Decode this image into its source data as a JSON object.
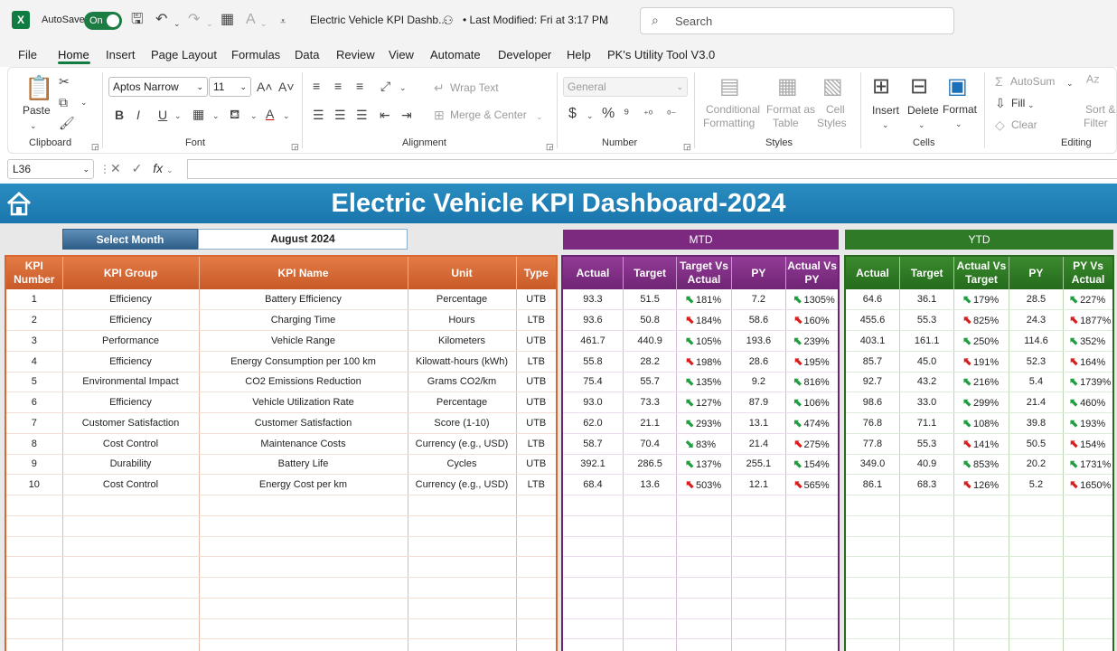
{
  "titlebar": {
    "autosave_label": "AutoSave",
    "autosave_state": "On",
    "doc_title": "Electric Vehicle KPI Dashb...",
    "last_modified": "• Last Modified: Fri at 3:17 PM",
    "search_placeholder": "Search"
  },
  "menu": [
    "File",
    "Home",
    "Insert",
    "Page Layout",
    "Formulas",
    "Data",
    "Review",
    "View",
    "Automate",
    "Developer",
    "Help",
    "PK's Utility Tool V3.0"
  ],
  "ribbon": {
    "paste": "Paste",
    "clipboard": "Clipboard",
    "font_name": "Aptos Narrow",
    "font_size": "11",
    "font": "Font",
    "wrap_text": "Wrap Text",
    "merge_center": "Merge & Center",
    "alignment": "Alignment",
    "number_format": "General",
    "number": "Number",
    "conditional_formatting_1": "Conditional",
    "conditional_formatting_2": "Formatting",
    "format_as_table_1": "Format as",
    "format_as_table_2": "Table",
    "cell_styles_1": "Cell",
    "cell_styles_2": "Styles",
    "styles": "Styles",
    "insert": "Insert",
    "delete": "Delete",
    "format": "Format",
    "cells": "Cells",
    "autosum": "AutoSum",
    "fill": "Fill",
    "clear": "Clear",
    "sort_filter_1": "Sort &",
    "sort_filter_2": "Filter",
    "editing": "Editing"
  },
  "formula_bar": {
    "name_box": "L36",
    "fx": "fx",
    "value": ""
  },
  "dashboard": {
    "title": "Electric Vehicle KPI Dashboard-2024",
    "select_month_label": "Select Month",
    "select_month_value": "August 2024",
    "mtd_label": "MTD",
    "ytd_label": "YTD"
  },
  "kpi_headers": [
    "KPI Number",
    "KPI Group",
    "KPI Name",
    "Unit",
    "Type"
  ],
  "mtd_headers": [
    "Actual",
    "Target",
    "Target Vs Actual",
    "PY",
    "Actual Vs PY"
  ],
  "ytd_headers": [
    "Actual",
    "Target",
    "Actual Vs Target",
    "PY",
    "PY Vs Actual"
  ],
  "rows": [
    {
      "num": "1",
      "group": "Efficiency",
      "name": "Battery Efficiency",
      "unit": "Percentage",
      "type": "UTB",
      "mtd": {
        "actual": "93.3",
        "target": "51.5",
        "tva_dir": "up",
        "tva": "181%",
        "py": "7.2",
        "avp_dir": "up",
        "avp": "1305%"
      },
      "ytd": {
        "actual": "64.6",
        "target": "36.1",
        "avt_dir": "up",
        "avt": "179%",
        "py": "28.5",
        "pva_dir": "up",
        "pva": "227%"
      }
    },
    {
      "num": "2",
      "group": "Efficiency",
      "name": "Charging Time",
      "unit": "Hours",
      "type": "LTB",
      "mtd": {
        "actual": "93.6",
        "target": "50.8",
        "tva_dir": "down",
        "tva": "184%",
        "py": "58.6",
        "avp_dir": "down",
        "avp": "160%"
      },
      "ytd": {
        "actual": "455.6",
        "target": "55.3",
        "avt_dir": "down",
        "avt": "825%",
        "py": "24.3",
        "pva_dir": "down",
        "pva": "1877%"
      }
    },
    {
      "num": "3",
      "group": "Performance",
      "name": "Vehicle Range",
      "unit": "Kilometers",
      "type": "UTB",
      "mtd": {
        "actual": "461.7",
        "target": "440.9",
        "tva_dir": "up",
        "tva": "105%",
        "py": "193.6",
        "avp_dir": "up",
        "avp": "239%"
      },
      "ytd": {
        "actual": "403.1",
        "target": "161.1",
        "avt_dir": "up",
        "avt": "250%",
        "py": "114.6",
        "pva_dir": "up",
        "pva": "352%"
      }
    },
    {
      "num": "4",
      "group": "Efficiency",
      "name": "Energy Consumption per 100 km",
      "unit": "Kilowatt-hours (kWh)",
      "type": "LTB",
      "mtd": {
        "actual": "55.8",
        "target": "28.2",
        "tva_dir": "down",
        "tva": "198%",
        "py": "28.6",
        "avp_dir": "down",
        "avp": "195%"
      },
      "ytd": {
        "actual": "85.7",
        "target": "45.0",
        "avt_dir": "down",
        "avt": "191%",
        "py": "52.3",
        "pva_dir": "down",
        "pva": "164%"
      }
    },
    {
      "num": "5",
      "group": "Environmental Impact",
      "name": "CO2 Emissions Reduction",
      "unit": "Grams CO2/km",
      "type": "UTB",
      "mtd": {
        "actual": "75.4",
        "target": "55.7",
        "tva_dir": "up",
        "tva": "135%",
        "py": "9.2",
        "avp_dir": "up",
        "avp": "816%"
      },
      "ytd": {
        "actual": "92.7",
        "target": "43.2",
        "avt_dir": "up",
        "avt": "216%",
        "py": "5.4",
        "pva_dir": "up",
        "pva": "1739%"
      }
    },
    {
      "num": "6",
      "group": "Efficiency",
      "name": "Vehicle Utilization Rate",
      "unit": "Percentage",
      "type": "UTB",
      "mtd": {
        "actual": "93.0",
        "target": "73.3",
        "tva_dir": "up",
        "tva": "127%",
        "py": "87.9",
        "avp_dir": "up",
        "avp": "106%"
      },
      "ytd": {
        "actual": "98.6",
        "target": "33.0",
        "avt_dir": "up",
        "avt": "299%",
        "py": "21.4",
        "pva_dir": "up",
        "pva": "460%"
      }
    },
    {
      "num": "7",
      "group": "Customer Satisfaction",
      "name": "Customer Satisfaction",
      "unit": "Score (1-10)",
      "type": "UTB",
      "mtd": {
        "actual": "62.0",
        "target": "21.1",
        "tva_dir": "up",
        "tva": "293%",
        "py": "13.1",
        "avp_dir": "up",
        "avp": "474%"
      },
      "ytd": {
        "actual": "76.8",
        "target": "71.1",
        "avt_dir": "up",
        "avt": "108%",
        "py": "39.8",
        "pva_dir": "up",
        "pva": "193%"
      }
    },
    {
      "num": "8",
      "group": "Cost Control",
      "name": "Maintenance Costs",
      "unit": "Currency (e.g., USD)",
      "type": "LTB",
      "mtd": {
        "actual": "58.7",
        "target": "70.4",
        "tva_dir": "up",
        "tva": "83%",
        "py": "21.4",
        "avp_dir": "down",
        "avp": "275%"
      },
      "ytd": {
        "actual": "77.8",
        "target": "55.3",
        "avt_dir": "down",
        "avt": "141%",
        "py": "50.5",
        "pva_dir": "down",
        "pva": "154%"
      }
    },
    {
      "num": "9",
      "group": "Durability",
      "name": "Battery Life",
      "unit": "Cycles",
      "type": "UTB",
      "mtd": {
        "actual": "392.1",
        "target": "286.5",
        "tva_dir": "up",
        "tva": "137%",
        "py": "255.1",
        "avp_dir": "up",
        "avp": "154%"
      },
      "ytd": {
        "actual": "349.0",
        "target": "40.9",
        "avt_dir": "up",
        "avt": "853%",
        "py": "20.2",
        "pva_dir": "up",
        "pva": "1731%"
      }
    },
    {
      "num": "10",
      "group": "Cost Control",
      "name": "Energy Cost per km",
      "unit": "Currency (e.g., USD)",
      "type": "LTB",
      "mtd": {
        "actual": "68.4",
        "target": "13.6",
        "tva_dir": "down",
        "tva": "503%",
        "py": "12.1",
        "avp_dir": "down",
        "avp": "565%"
      },
      "ytd": {
        "actual": "86.1",
        "target": "68.3",
        "avt_dir": "down",
        "avt": "126%",
        "py": "5.2",
        "pva_dir": "down",
        "pva": "1650%"
      }
    }
  ],
  "empty_rows": 8,
  "colors": {
    "excel_green": "#107c41",
    "banner": "#1a76ad",
    "kpi_orange": "#d86733",
    "mtd_purple": "#7c2a80",
    "ytd_green": "#2f7a26",
    "up_arrow": "#1f9e3f",
    "down_arrow": "#d81e1e"
  }
}
